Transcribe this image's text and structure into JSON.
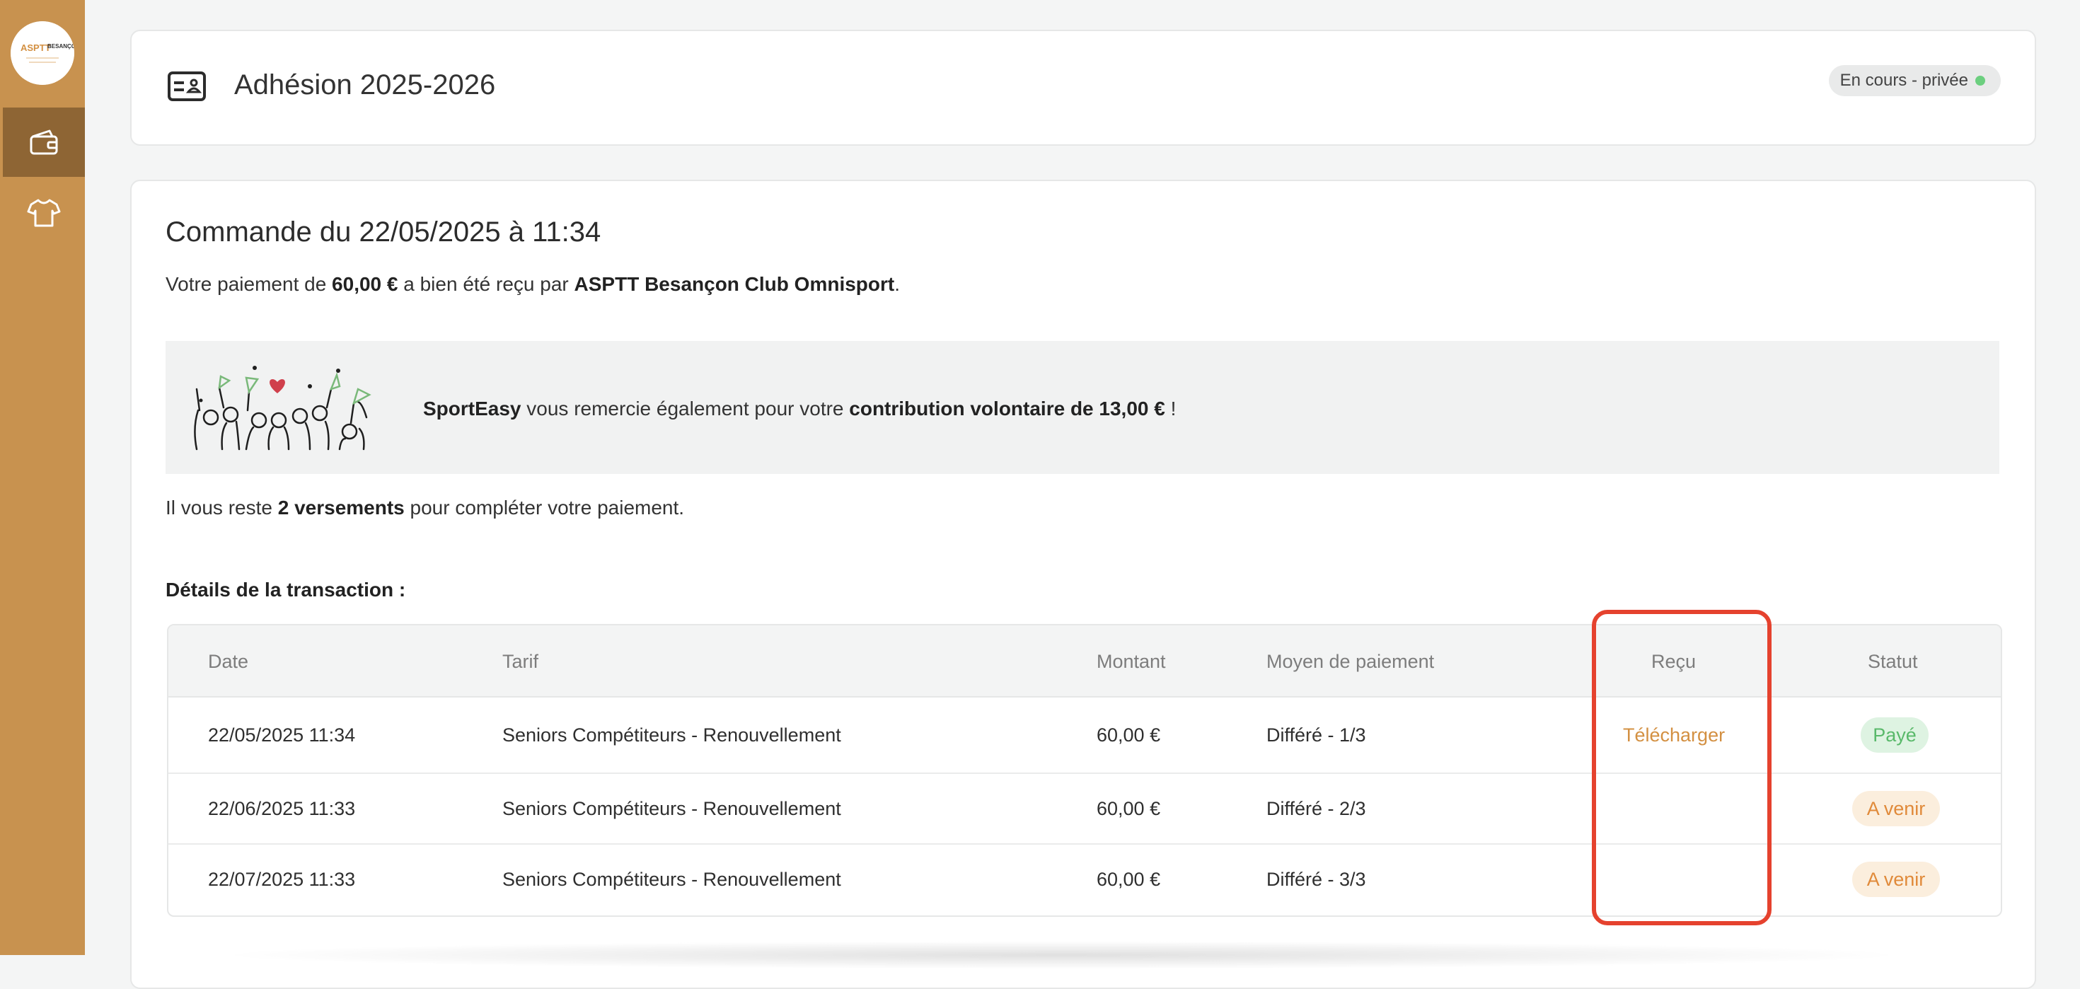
{
  "sidebar": {
    "logo_text": "ASPTT BESANÇON",
    "items": [
      {
        "icon": "wallet-icon",
        "active": true
      },
      {
        "icon": "tshirt-icon",
        "active": false
      }
    ]
  },
  "header": {
    "icon": "id-card-icon",
    "title": "Adhésion 2025-2026",
    "status_pill": "En cours - privée",
    "status_color": "#6ccf7f"
  },
  "order": {
    "title": "Commande du 22/05/2025 à 11:34",
    "payment_prefix": "Votre paiement de ",
    "payment_amount": "60,00 €",
    "payment_middle": " a bien été reçu par ",
    "club_name": "ASPTT Besançon Club Omnisport",
    "payment_suffix": "."
  },
  "thanks": {
    "brand": "SportEasy",
    "text_middle": " vous remercie également pour votre ",
    "contribution": "contribution volontaire de 13,00 €",
    "text_suffix": " !"
  },
  "remaining": {
    "prefix": "Il vous reste ",
    "count": "2 versements",
    "suffix": " pour compléter votre paiement."
  },
  "details_label": "Détails de la transaction :",
  "table": {
    "columns": [
      "Date",
      "Tarif",
      "Montant",
      "Moyen de paiement",
      "Reçu",
      "Statut"
    ],
    "rows": [
      {
        "date": "22/05/2025 11:34",
        "tarif": "Seniors Compétiteurs - Renouvellement",
        "montant": "60,00 €",
        "moyen": "Différé - 1/3",
        "recu": "Télécharger",
        "statut": "Payé"
      },
      {
        "date": "22/06/2025 11:33",
        "tarif": "Seniors Compétiteurs - Renouvellement",
        "montant": "60,00 €",
        "moyen": "Différé - 2/3",
        "recu": "",
        "statut": "A venir"
      },
      {
        "date": "22/07/2025 11:33",
        "tarif": "Seniors Compétiteurs - Renouvellement",
        "montant": "60,00 €",
        "moyen": "Différé - 3/3",
        "recu": "",
        "statut": "A venir"
      }
    ]
  },
  "colors": {
    "sidebar": "#c8924f",
    "sidebar_active": "#8e6534",
    "link": "#d39042",
    "paid": "#59b96a",
    "upcoming": "#e08a3a",
    "highlight": "#e5422e"
  }
}
